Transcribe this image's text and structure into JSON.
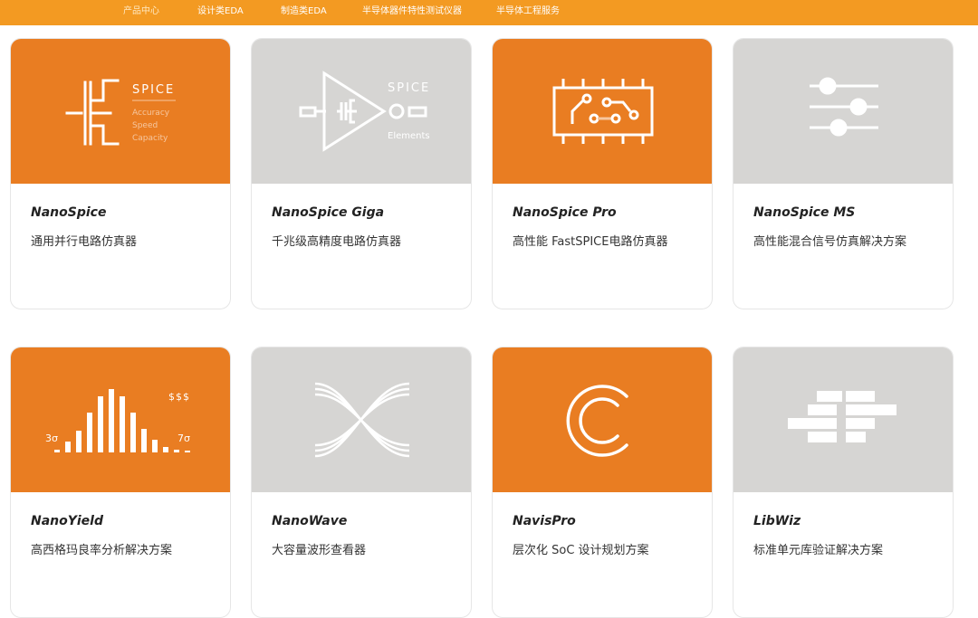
{
  "nav": {
    "items": [
      "产品中心",
      "设计类EDA",
      "制造类EDA",
      "半导体器件特性测试仪器",
      "半导体工程服务"
    ]
  },
  "cards": [
    {
      "name": "NanoSpice",
      "desc": "通用并行电路仿真器",
      "art_text": [
        "SPICE",
        "Accuracy",
        "Speed",
        "Capacity"
      ]
    },
    {
      "name": "NanoSpice Giga",
      "desc": "千兆级高精度电路仿真器",
      "art_text": [
        "SPICE",
        "Elements"
      ]
    },
    {
      "name": "NanoSpice Pro",
      "desc": "高性能 FastSPICE电路仿真器"
    },
    {
      "name": "NanoSpice MS",
      "desc": "高性能混合信号仿真解决方案"
    },
    {
      "name": "NanoYield",
      "desc": "高西格玛良率分析解决方案",
      "art_text": [
        "$$$",
        "3σ",
        "7σ"
      ]
    },
    {
      "name": "NanoWave",
      "desc": "大容量波形查看器"
    },
    {
      "name": "NavisPro",
      "desc": "层次化 SoC 设计规划方案"
    },
    {
      "name": "LibWiz",
      "desc": "标准单元库验证解决方案"
    }
  ],
  "colors": {
    "nav_bg": "#f39a22",
    "orange_thumb": "#e97d22",
    "gray_thumb": "#d6d5d3"
  }
}
